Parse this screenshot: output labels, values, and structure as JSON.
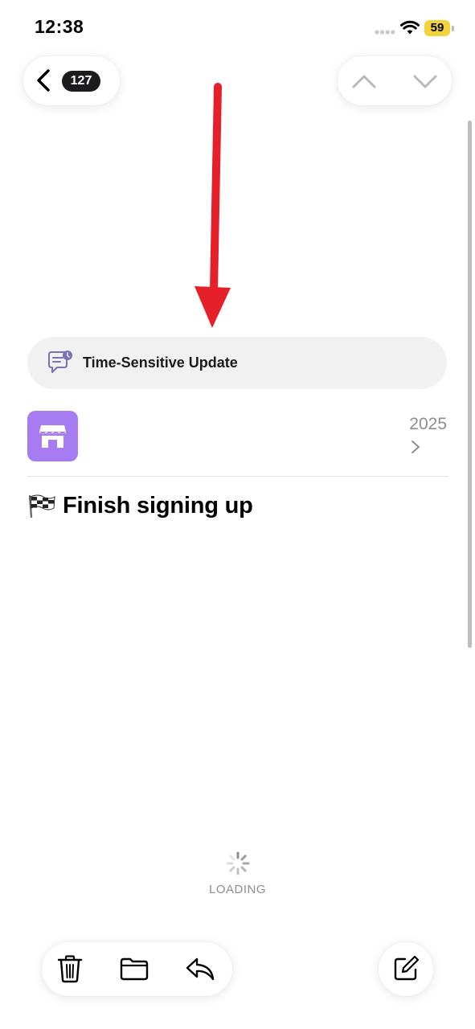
{
  "status_bar": {
    "time": "12:38",
    "battery": "59",
    "icons": [
      "signal-dots-icon",
      "wifi-icon",
      "battery-icon"
    ]
  },
  "navigation": {
    "back_icon": "chevron-left-icon",
    "message_count": "127",
    "up_icon": "chevron-up-icon",
    "down_icon": "chevron-down-icon"
  },
  "annotation": {
    "arrow_color": "#e5202a",
    "icon": "red-arrow-down-icon"
  },
  "banner": {
    "icon": "time-sensitive-message-icon",
    "label": "Time-Sensitive Update",
    "background": "#f1f1f2"
  },
  "message": {
    "sender_avatar_icon": "storefront-icon",
    "avatar_color": "#a77bf2",
    "date": "2025",
    "detail_icon": "chevron-right-icon",
    "subject_emoji_icon": "checkered-flag-icon",
    "subject": "Finish signing up"
  },
  "loading": {
    "icon": "spinner-icon",
    "label": "LOADING"
  },
  "toolbar": {
    "trash_icon": "trash-icon",
    "folder_icon": "folder-icon",
    "reply_icon": "reply-icon",
    "compose_icon": "compose-icon"
  }
}
